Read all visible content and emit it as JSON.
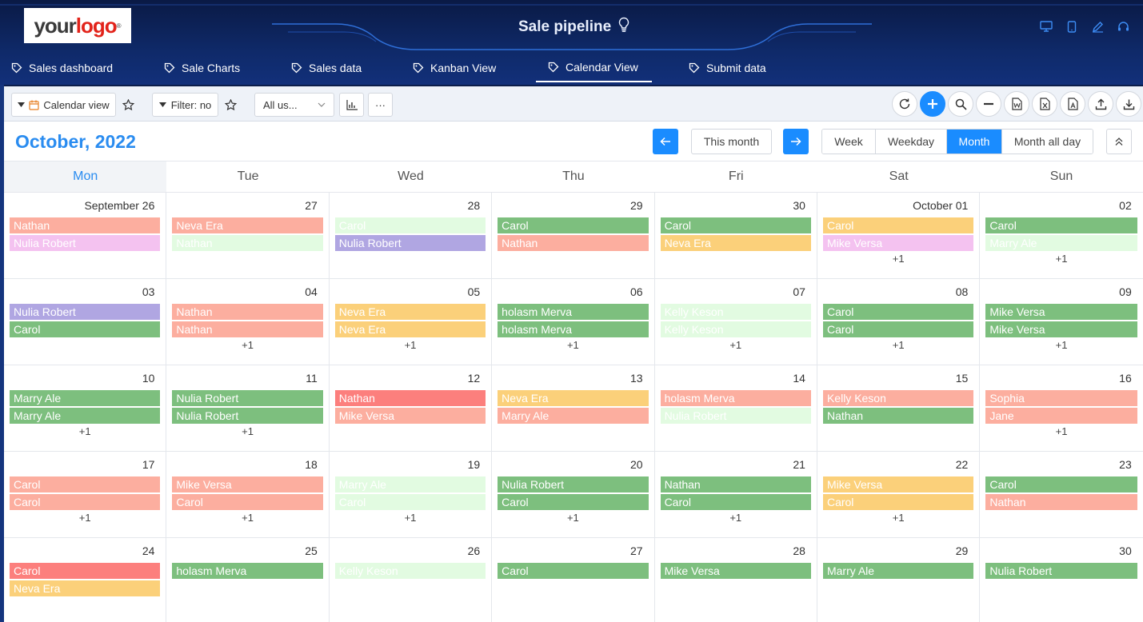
{
  "colors": {
    "green": "#7dbf7e",
    "salmon": "#fcae9f",
    "red": "#fc7f7d",
    "yellow": "#fbd07a",
    "pink": "#f4c2f0",
    "purple": "#b0a6e2",
    "mint": "#e2fbe1",
    "accent": "#1a8cff"
  },
  "logo": {
    "word1": "your",
    "word2": "logo",
    "mark": "®"
  },
  "app": {
    "title": "Sale pipeline",
    "title_icon": "lightbulb-icon"
  },
  "header_tools": [
    "monitor-icon",
    "tablet-icon",
    "edit-icon",
    "headset-icon"
  ],
  "nav": {
    "items": [
      {
        "label": "Sales dashboard",
        "active": false
      },
      {
        "label": "Sale Charts",
        "active": false
      },
      {
        "label": "Sales data",
        "active": false
      },
      {
        "label": "Kanban View",
        "active": false
      },
      {
        "label": "Calendar View",
        "active": true
      },
      {
        "label": "Submit data",
        "active": false
      }
    ]
  },
  "toolbar": {
    "view_label": "Calendar view",
    "filter_label": "Filter: no",
    "users_select": "All us...",
    "more_label": "···"
  },
  "calendar": {
    "month_title": "October, 2022",
    "this_month": "This month",
    "views": [
      {
        "label": "Week",
        "active": false
      },
      {
        "label": "Weekday",
        "active": false
      },
      {
        "label": "Month",
        "active": true
      },
      {
        "label": "Month all day",
        "active": false
      }
    ],
    "weekdays": [
      "Mon",
      "Tue",
      "Wed",
      "Thu",
      "Fri",
      "Sat",
      "Sun"
    ],
    "weeks": [
      [
        {
          "num": "September 26",
          "events": [
            {
              "name": "Nathan",
              "color": "salmon"
            },
            {
              "name": "Nulia Robert",
              "color": "pink"
            }
          ],
          "more": ""
        },
        {
          "num": "27",
          "events": [
            {
              "name": "Neva Era",
              "color": "salmon"
            },
            {
              "name": "Nathan",
              "color": "mint"
            }
          ],
          "more": ""
        },
        {
          "num": "28",
          "events": [
            {
              "name": "Carol",
              "color": "mint"
            },
            {
              "name": "Nulia Robert",
              "color": "purple"
            }
          ],
          "more": ""
        },
        {
          "num": "29",
          "events": [
            {
              "name": "Carol",
              "color": "green"
            },
            {
              "name": "Nathan",
              "color": "salmon"
            }
          ],
          "more": ""
        },
        {
          "num": "30",
          "events": [
            {
              "name": "Carol",
              "color": "green"
            },
            {
              "name": "Neva Era",
              "color": "yellow"
            }
          ],
          "more": ""
        },
        {
          "num": "October 01",
          "events": [
            {
              "name": "Carol",
              "color": "yellow"
            },
            {
              "name": "Mike Versa",
              "color": "pink"
            }
          ],
          "more": "+1"
        },
        {
          "num": "02",
          "events": [
            {
              "name": "Carol",
              "color": "green"
            },
            {
              "name": "Marry Ale",
              "color": "mint"
            }
          ],
          "more": "+1"
        }
      ],
      [
        {
          "num": "03",
          "events": [
            {
              "name": "Nulia Robert",
              "color": "purple"
            },
            {
              "name": "Carol",
              "color": "green"
            }
          ],
          "more": ""
        },
        {
          "num": "04",
          "events": [
            {
              "name": "Nathan",
              "color": "salmon"
            },
            {
              "name": "Nathan",
              "color": "salmon"
            }
          ],
          "more": "+1"
        },
        {
          "num": "05",
          "events": [
            {
              "name": "Neva Era",
              "color": "yellow"
            },
            {
              "name": "Neva Era",
              "color": "yellow"
            }
          ],
          "more": "+1"
        },
        {
          "num": "06",
          "events": [
            {
              "name": "holasm Merva",
              "color": "green"
            },
            {
              "name": "holasm Merva",
              "color": "green"
            }
          ],
          "more": "+1"
        },
        {
          "num": "07",
          "events": [
            {
              "name": "Kelly Keson",
              "color": "mint"
            },
            {
              "name": "Kelly Keson",
              "color": "mint"
            }
          ],
          "more": "+1"
        },
        {
          "num": "08",
          "events": [
            {
              "name": "Carol",
              "color": "green"
            },
            {
              "name": "Carol",
              "color": "green"
            }
          ],
          "more": "+1"
        },
        {
          "num": "09",
          "events": [
            {
              "name": "Mike Versa",
              "color": "green"
            },
            {
              "name": "Mike Versa",
              "color": "green"
            }
          ],
          "more": "+1"
        }
      ],
      [
        {
          "num": "10",
          "events": [
            {
              "name": "Marry Ale",
              "color": "green"
            },
            {
              "name": "Marry Ale",
              "color": "green"
            }
          ],
          "more": "+1"
        },
        {
          "num": "11",
          "events": [
            {
              "name": "Nulia Robert",
              "color": "green"
            },
            {
              "name": "Nulia Robert",
              "color": "green"
            }
          ],
          "more": "+1"
        },
        {
          "num": "12",
          "events": [
            {
              "name": "Nathan",
              "color": "red"
            },
            {
              "name": "Mike Versa",
              "color": "salmon"
            }
          ],
          "more": ""
        },
        {
          "num": "13",
          "events": [
            {
              "name": "Neva Era",
              "color": "yellow"
            },
            {
              "name": "Marry Ale",
              "color": "salmon"
            }
          ],
          "more": ""
        },
        {
          "num": "14",
          "events": [
            {
              "name": "holasm Merva",
              "color": "salmon"
            },
            {
              "name": "Nulia Robert",
              "color": "mint"
            }
          ],
          "more": ""
        },
        {
          "num": "15",
          "events": [
            {
              "name": "Kelly Keson",
              "color": "salmon"
            },
            {
              "name": "Nathan",
              "color": "green"
            }
          ],
          "more": ""
        },
        {
          "num": "16",
          "events": [
            {
              "name": "Sophia",
              "color": "salmon"
            },
            {
              "name": "Jane",
              "color": "salmon"
            }
          ],
          "more": "+1"
        }
      ],
      [
        {
          "num": "17",
          "events": [
            {
              "name": "Carol",
              "color": "salmon"
            },
            {
              "name": "Carol",
              "color": "salmon"
            }
          ],
          "more": "+1"
        },
        {
          "num": "18",
          "events": [
            {
              "name": "Mike Versa",
              "color": "salmon"
            },
            {
              "name": "Carol",
              "color": "salmon"
            }
          ],
          "more": "+1"
        },
        {
          "num": "19",
          "events": [
            {
              "name": "Marry Ale",
              "color": "mint"
            },
            {
              "name": "Carol",
              "color": "mint"
            }
          ],
          "more": "+1"
        },
        {
          "num": "20",
          "events": [
            {
              "name": "Nulia Robert",
              "color": "green"
            },
            {
              "name": "Carol",
              "color": "green"
            }
          ],
          "more": "+1"
        },
        {
          "num": "21",
          "events": [
            {
              "name": "Nathan",
              "color": "green"
            },
            {
              "name": "Carol",
              "color": "green"
            }
          ],
          "more": "+1"
        },
        {
          "num": "22",
          "events": [
            {
              "name": "Mike Versa",
              "color": "yellow"
            },
            {
              "name": "Carol",
              "color": "yellow"
            }
          ],
          "more": "+1"
        },
        {
          "num": "23",
          "events": [
            {
              "name": "Carol",
              "color": "green"
            },
            {
              "name": "Nathan",
              "color": "salmon"
            }
          ],
          "more": ""
        }
      ],
      [
        {
          "num": "24",
          "events": [
            {
              "name": "Carol",
              "color": "red"
            },
            {
              "name": "Neva Era",
              "color": "yellow"
            }
          ],
          "more": ""
        },
        {
          "num": "25",
          "events": [
            {
              "name": "holasm Merva",
              "color": "green"
            }
          ],
          "more": ""
        },
        {
          "num": "26",
          "events": [
            {
              "name": "Kelly Keson",
              "color": "mint"
            }
          ],
          "more": ""
        },
        {
          "num": "27",
          "events": [
            {
              "name": "Carol",
              "color": "green"
            }
          ],
          "more": ""
        },
        {
          "num": "28",
          "events": [
            {
              "name": "Mike Versa",
              "color": "green"
            }
          ],
          "more": ""
        },
        {
          "num": "29",
          "events": [
            {
              "name": "Marry Ale",
              "color": "green"
            }
          ],
          "more": ""
        },
        {
          "num": "30",
          "events": [
            {
              "name": "Nulia Robert",
              "color": "green"
            }
          ],
          "more": ""
        }
      ]
    ]
  }
}
